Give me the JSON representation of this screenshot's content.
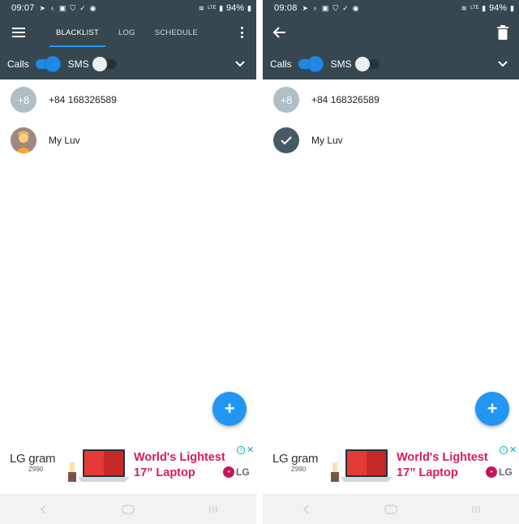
{
  "left": {
    "status": {
      "time": "09:07",
      "battery": "94%"
    },
    "toolbar": {
      "tabs": [
        "BLACKLIST",
        "LOG",
        "SCHEDULE"
      ],
      "active_tab": "BLACKLIST"
    },
    "filters": {
      "calls_label": "Calls",
      "calls_on": true,
      "sms_label": "SMS",
      "sms_on": false
    },
    "items": [
      {
        "avatar_text": "+8",
        "label": "+84 168326589",
        "avatar_type": "initials"
      },
      {
        "avatar_text": "",
        "label": "My Luv",
        "avatar_type": "photo"
      }
    ],
    "fab_label": "+"
  },
  "right": {
    "status": {
      "time": "09:08",
      "battery": "94%"
    },
    "toolbar": {
      "mode": "selection"
    },
    "filters": {
      "calls_label": "Calls",
      "calls_on": true,
      "sms_label": "SMS",
      "sms_on": false
    },
    "items": [
      {
        "avatar_text": "+8",
        "label": "+84 168326589",
        "avatar_type": "initials"
      },
      {
        "avatar_text": "",
        "label": "My Luv",
        "avatar_type": "selected-check"
      }
    ],
    "fab_label": "+"
  },
  "ad": {
    "brand": "LG gram",
    "model": "Z990",
    "headline_line1": "World's Lightest",
    "headline_line2": "17” Laptop",
    "logo_text": "LG",
    "info_symbol": "i",
    "close_symbol": "✕"
  },
  "status_icons": {
    "lte_label": "LTE"
  },
  "colors": {
    "toolbar": "#37474f",
    "accent": "#2196f3",
    "ad_headline": "#d81b60"
  }
}
